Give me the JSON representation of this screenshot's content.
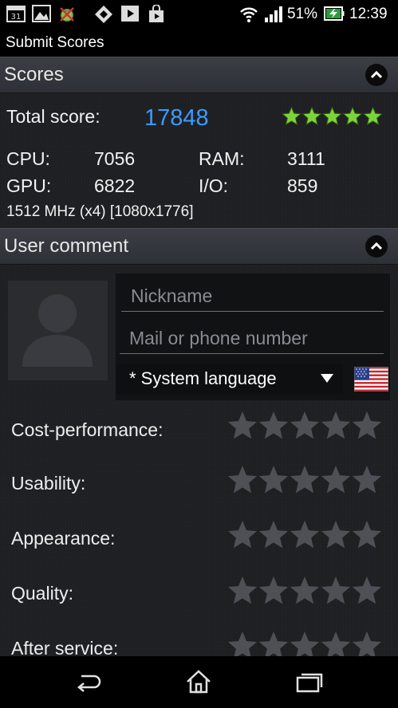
{
  "status_bar": {
    "calendar_day": "31",
    "battery_percent": "51%",
    "time": "12:39",
    "icons": [
      "calendar-icon",
      "gallery-icon",
      "android-debug-icon",
      "store-icon",
      "play-movies-icon",
      "play-store-icon",
      "wifi-icon",
      "signal-icon",
      "battery-charging-icon"
    ]
  },
  "app": {
    "title": "Submit Scores"
  },
  "scores": {
    "section_title": "Scores",
    "total_label": "Total score:",
    "total_value": "17848",
    "total_stars": 5,
    "cpu_label": "CPU:",
    "cpu_value": "7056",
    "ram_label": "RAM:",
    "ram_value": "3111",
    "gpu_label": "GPU:",
    "gpu_value": "6822",
    "io_label": "I/O:",
    "io_value": "859",
    "device_info": "1512 MHz (x4) [1080x1776]"
  },
  "comment": {
    "section_title": "User comment",
    "nickname_placeholder": "Nickname",
    "contact_placeholder": "Mail or phone number",
    "language_value": "* System language",
    "ratings": [
      {
        "label": "Cost-performance:",
        "stars": 0
      },
      {
        "label": "Usability:",
        "stars": 0
      },
      {
        "label": "Appearance:",
        "stars": 0
      },
      {
        "label": "Quality:",
        "stars": 0
      },
      {
        "label": "After service:",
        "stars": 0
      }
    ]
  },
  "colors": {
    "accent_blue": "#3b9bff",
    "star_green": "#7cd43a",
    "star_empty": "#4e5056"
  },
  "nav_bar": {
    "icons": [
      "back-icon",
      "home-icon",
      "recent-apps-icon"
    ]
  }
}
